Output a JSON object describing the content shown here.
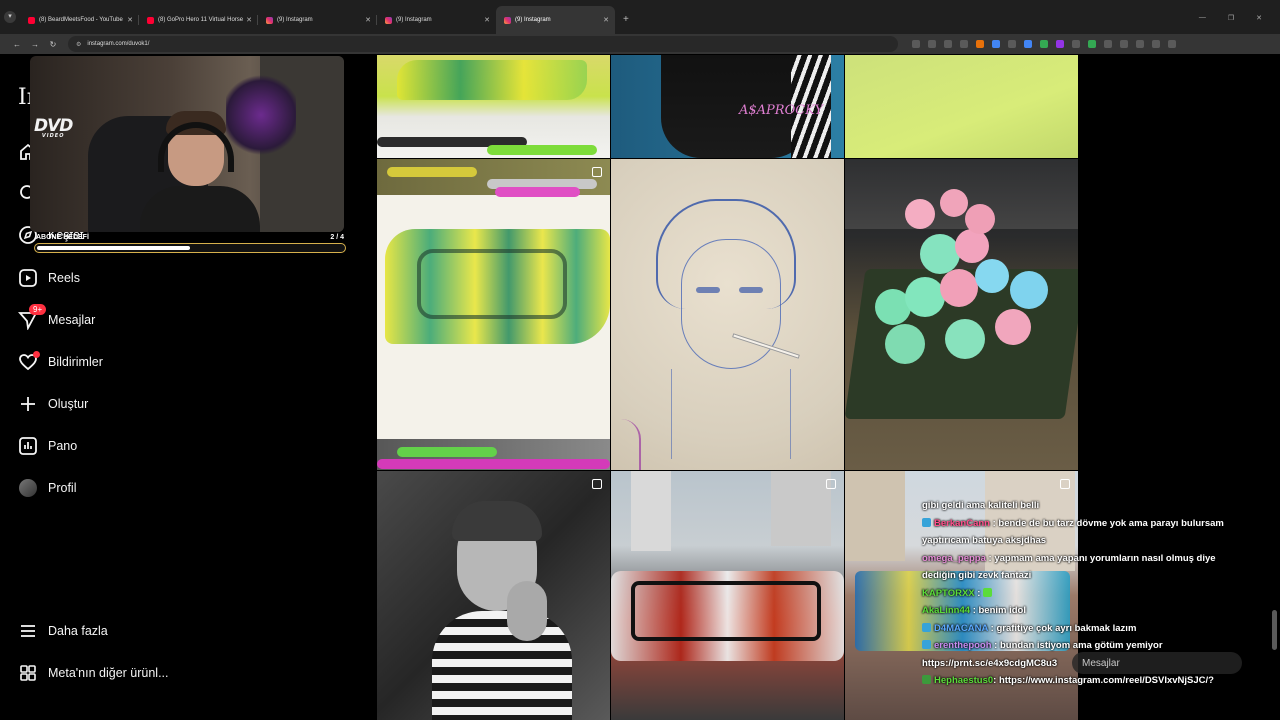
{
  "browser": {
    "tabs": [
      {
        "title": "(8) BeardMeetsFood - YouTube",
        "type": "yt",
        "active": false
      },
      {
        "title": "(8) GoPro Hero 11 Virtual Horse",
        "type": "yt",
        "active": false
      },
      {
        "title": "(9) Instagram",
        "type": "ig",
        "active": false
      },
      {
        "title": "(9) Instagram",
        "type": "ig",
        "active": false
      },
      {
        "title": "(9) Instagram",
        "type": "ig",
        "active": true
      }
    ],
    "new_tab": "+",
    "url": "instagram.com/duvok1/"
  },
  "sidebar": {
    "logo": "In",
    "items": [
      {
        "label": "",
        "icon": "home-icon"
      },
      {
        "label": "",
        "icon": "search-icon"
      },
      {
        "label": "Keşfet",
        "icon": "compass-icon"
      },
      {
        "label": "Reels",
        "icon": "reels-icon"
      },
      {
        "label": "Mesajlar",
        "icon": "messenger-icon",
        "badge": "9+"
      },
      {
        "label": "Bildirimler",
        "icon": "heart-icon",
        "dot": true
      },
      {
        "label": "Oluştur",
        "icon": "plus-icon"
      },
      {
        "label": "Pano",
        "icon": "dashboard-icon"
      },
      {
        "label": "Profil",
        "icon": "avatar"
      }
    ],
    "more": "Daha fazla",
    "meta": "Meta'nın diğer ürünl..."
  },
  "stream": {
    "dvd_logo": "DVD",
    "dvd_sub": "VIDEO",
    "goal_label": "ABONE HEDEFİ",
    "goal_count": "2 / 4",
    "goal_progress": 0.5
  },
  "grid": {
    "post_texts": {
      "asap": "A$APROCKY"
    }
  },
  "chat": [
    {
      "user": "",
      "text": "gibi geldi ama kaliteli belli",
      "color": "#ffffff"
    },
    {
      "user": "BerkanCann",
      "text": ": bende de bu tarz dövme yok ama parayı bulursam",
      "color": "#ff4f8b"
    },
    {
      "user": "",
      "text": "yaptırıcam batuya aksjdhas",
      "color": "#ffffff"
    },
    {
      "user": "omega_peppa",
      "text": ": yapmam ama yapanı yorumların nasıl olmuş diye",
      "color": "#e58cd6"
    },
    {
      "user": "",
      "text": "dediğin gibi zevk fantazi",
      "color": "#ffffff"
    },
    {
      "user": "KAPTORXX",
      "text": ":",
      "color": "#5bdc3a"
    },
    {
      "user": "AkaLinn44",
      "text": ": benim idol",
      "color": "#5bdc3a"
    },
    {
      "user": "D4MACANA",
      "text": ": grafitiye çok ayrı bakmak lazım",
      "color": "#5aa9ff"
    },
    {
      "user": "erenthepooh",
      "text": ": bundan istiyom ama götüm yemiyor",
      "color": "#c88cf0"
    },
    {
      "user": "",
      "text": "https://prnt.sc/e4x9cdgMC8u3",
      "color": "#ffffff"
    },
    {
      "user": "Hephaestus0",
      "text": ": https://www.instagram.com/reel/DSVIxvNjSJC/?",
      "color": "#5bdc3a"
    }
  ],
  "messages_pill": "Mesajlar",
  "messages_badge": "9+"
}
